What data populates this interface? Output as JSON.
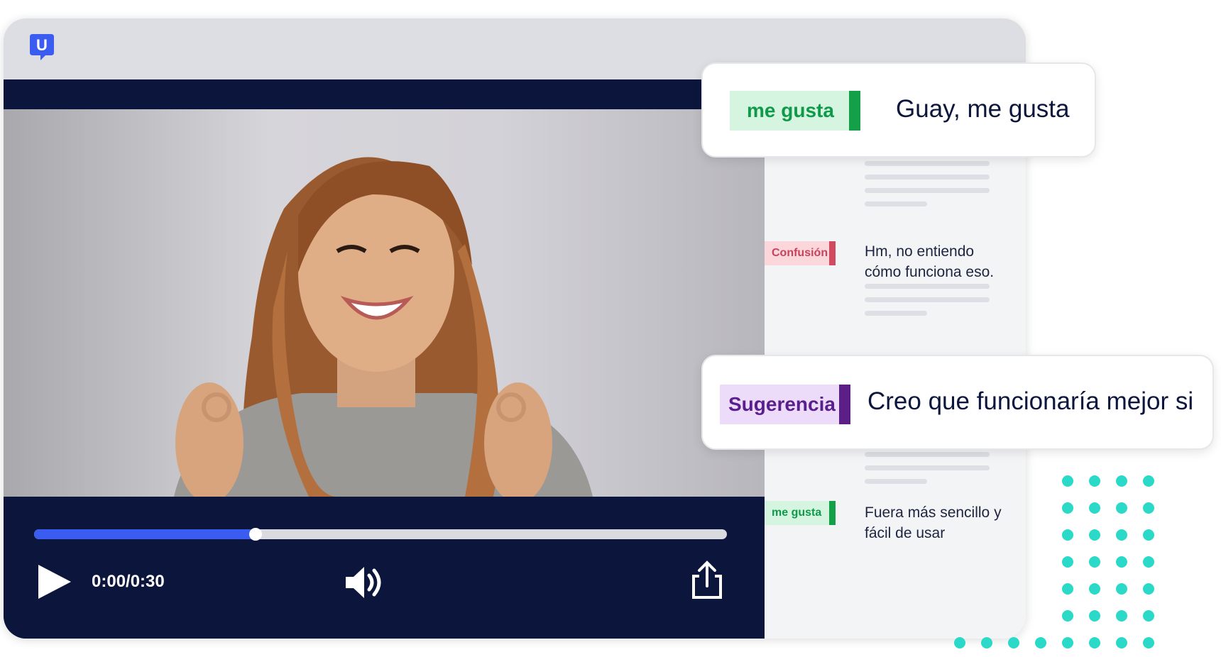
{
  "app": {
    "logo_letter": "U",
    "brand_color": "#3a5cf0"
  },
  "player": {
    "time": "0:00/0:30",
    "progress": 0.32,
    "play_icon": "play-icon",
    "volume_icon": "volume-icon",
    "share_icon": "share-icon",
    "progress_color": "#3a5cf0"
  },
  "highlight_cards": [
    {
      "tag": "me gusta",
      "text": "Guay, me gusta",
      "tag_bg": "#d5f5e1",
      "tag_color": "#0e9a48",
      "bar_color": "#13a048"
    },
    {
      "tag": "Sugerencia",
      "text": "Creo que funcionaría mejor si",
      "tag_bg": "#ecdcfa",
      "tag_color": "#5a1f8e",
      "bar_color": "#5b1f87"
    }
  ],
  "transcript": [
    {
      "tag": "Confusión",
      "text": "Hm, no entiendo cómo funciona eso.",
      "tag_bg": "#fbd7dc",
      "tag_color": "#c8425a",
      "bar_color": "#d24a60"
    },
    {
      "tag": "me gusta",
      "text": "Fuera más sencillo y fácil de usar",
      "tag_bg": "#d5f5e1",
      "tag_color": "#0e9a48",
      "bar_color": "#13a048"
    }
  ],
  "decoration": {
    "dots_color": "#2bd9c9"
  }
}
